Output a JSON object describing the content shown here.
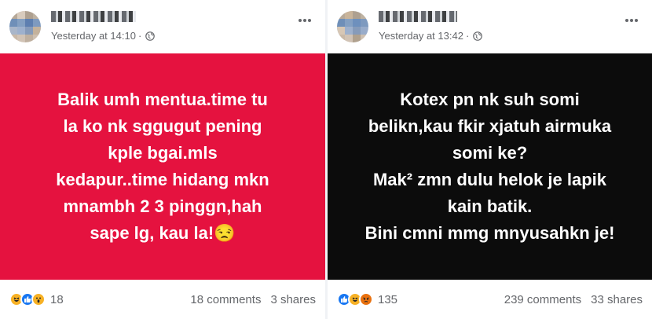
{
  "posts": [
    {
      "timestamp": "Yesterday at 14:10",
      "privacy_icon": "globe-icon",
      "more_icon": "ellipsis-icon",
      "background": "#e5123f",
      "text": "Balik umh mentua.time tu\nla ko nk sggugut pening\nkple bgai.mls\nkedapur..time hidang mkn\nmnambh 2 3 pinggn,hah\nsape lg, kau la!😒",
      "reactions": [
        "haha",
        "like",
        "wow"
      ],
      "reaction_count": "18",
      "comments": "18 comments",
      "shares": "3 shares"
    },
    {
      "timestamp": "Yesterday at 13:42",
      "privacy_icon": "globe-icon",
      "more_icon": "ellipsis-icon",
      "background": "#0c0c0c",
      "text": "Kotex pn nk suh somi\nbelikn,kau fkir xjatuh airmuka\nsomi ke?\nMak² zmn dulu helok je lapik\nkain batik.\nBini cmni mmg mnyusahkn je!",
      "reactions": [
        "like",
        "haha",
        "angry"
      ],
      "reaction_count": "135",
      "comments": "239 comments",
      "shares": "33 shares"
    }
  ]
}
